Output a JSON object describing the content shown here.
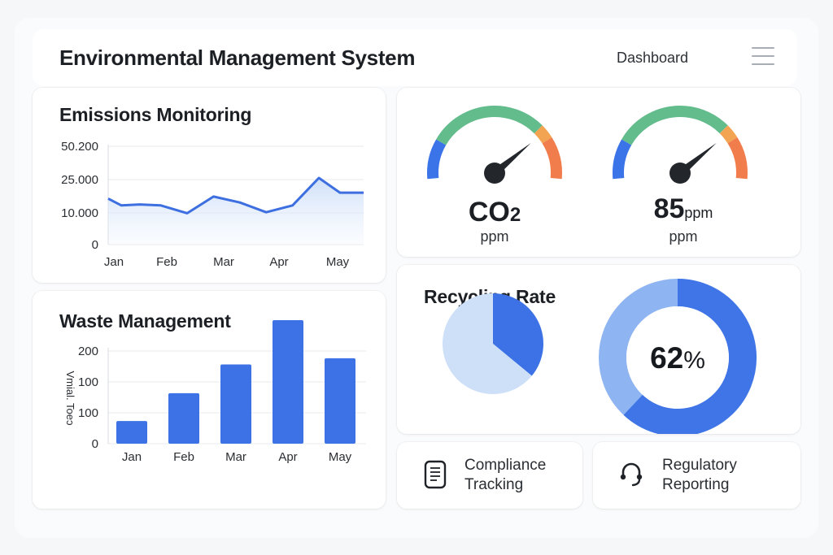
{
  "header": {
    "title": "Environmental Management System",
    "nav_link": "Dashboard"
  },
  "emissions": {
    "title": "Emissions Monitoring",
    "chart_data": {
      "type": "area",
      "categories": [
        "Jan",
        "Feb",
        "Mar",
        "Apr",
        "May"
      ],
      "y_ticks": [
        {
          "label": "50.200",
          "value": 50200
        },
        {
          "label": "25.000",
          "value": 25000
        },
        {
          "label": "10.000",
          "value": 10000
        },
        {
          "label": "0",
          "value": 0
        }
      ],
      "ylim": [
        0,
        50200
      ],
      "x": [
        0,
        0.25,
        0.6,
        1.0,
        1.5,
        2.0,
        2.5,
        3.0,
        3.5,
        4.0,
        4.4,
        4.85
      ],
      "values": [
        23500,
        20000,
        20500,
        20000,
        16000,
        24500,
        21500,
        16500,
        20000,
        34000,
        26500,
        26500
      ],
      "grid": true
    }
  },
  "waste": {
    "title": "Waste Management",
    "chart_data": {
      "type": "bar",
      "categories": [
        "Jan",
        "Feb",
        "Mar",
        "Apr",
        "May"
      ],
      "y_ticks": [
        "200",
        "100",
        "100",
        "0"
      ],
      "ylabel": "Vmial. Toeɔ",
      "values_frac": [
        0.22,
        0.49,
        0.77,
        1.2,
        0.83
      ],
      "color": "#3d72e6",
      "grid": true
    }
  },
  "gauges": [
    {
      "value": "CO2",
      "value_main": "CO",
      "value_sub": "2",
      "unit_inline": "",
      "sub": "ppm",
      "needle_frac": 0.78
    },
    {
      "value": "85",
      "value_main": "85",
      "value_sub": "",
      "unit_inline": "ppm",
      "sub": "ppm",
      "needle_frac": 0.78
    }
  ],
  "gauge_colors": {
    "blue": "#3b74e8",
    "green": "#62bc8c",
    "orange_light": "#f2a452",
    "orange": "#f17d4c",
    "needle": "#23272c"
  },
  "recycling": {
    "title": "Recycling Rate",
    "pie": {
      "type": "pie",
      "values": [
        36,
        64
      ],
      "colors": [
        "#3d72e6",
        "#cde0f8"
      ]
    },
    "donut": {
      "label_num": "62",
      "label_pct": "%",
      "value": 62,
      "colors": [
        "#3f75e6",
        "#8eb5f2"
      ]
    }
  },
  "actions": [
    {
      "label_line1": "Compliance",
      "label_line2": "Tracking",
      "icon": "document-icon"
    },
    {
      "label_line1": "Regulatory",
      "label_line2": "Reporting",
      "icon": "headset-icon"
    }
  ]
}
